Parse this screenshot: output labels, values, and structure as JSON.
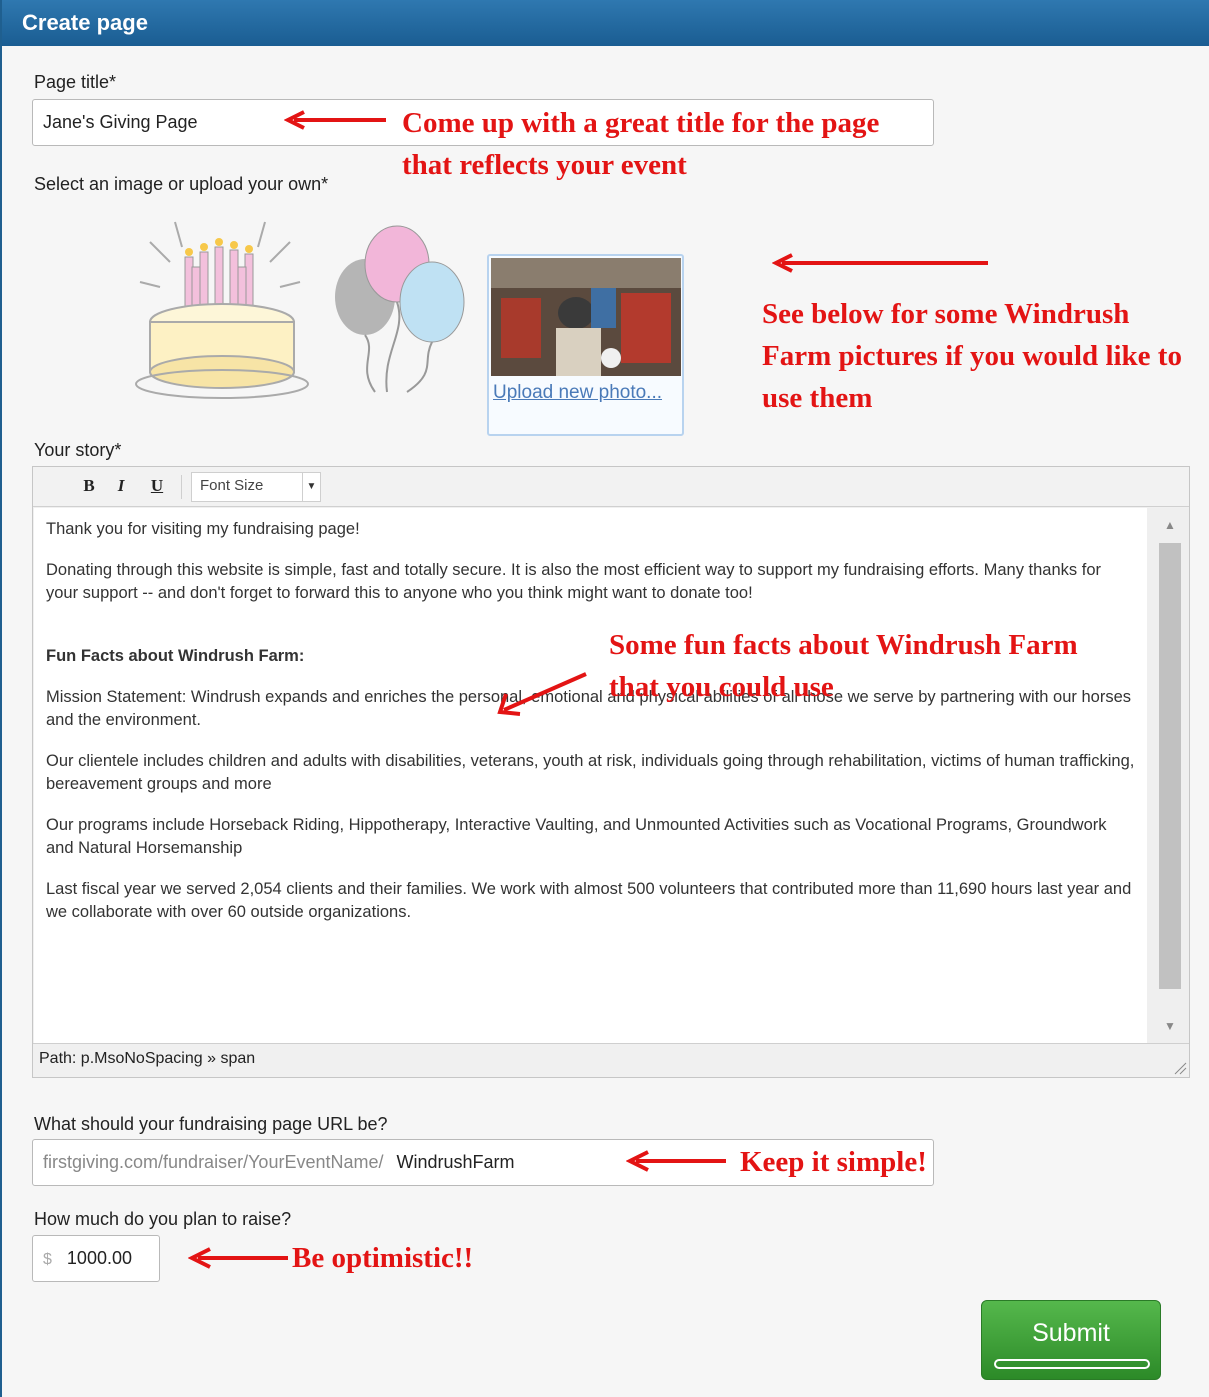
{
  "header": {
    "title": "Create page"
  },
  "page_title": {
    "label": "Page title*",
    "value": "Jane's Giving Page"
  },
  "image_select": {
    "label": "Select an image or upload your own*",
    "upload_link": "Upload new photo..."
  },
  "story": {
    "label": "Your story*",
    "toolbar": {
      "bold": "B",
      "italic": "I",
      "underline": "U",
      "font_size": "Font Size"
    },
    "paragraphs": [
      "Thank you for visiting my fundraising page!",
      "Donating through this website is simple, fast and totally secure. It is also the most efficient way to support my fundraising efforts. Many thanks for your support -- and don't forget to forward this to anyone who you think might want to donate too!",
      "Fun Facts about Windrush Farm:",
      "Mission Statement: Windrush expands and enriches the personal, emotional and physical abilities of all those we serve by partnering with our horses and the environment.",
      "Our clientele includes children and adults with disabilities, veterans, youth at risk, individuals going through rehabilitation, victims of human trafficking, bereavement groups and more",
      "Our programs include Horseback Riding, Hippotherapy, Interactive Vaulting, and Unmounted Activities such as Vocational Programs, Groundwork and Natural Horsemanship",
      "Last fiscal year we served 2,054 clients and their families. We work with almost 500 volunteers that contributed more than 11,690 hours last year and we collaborate with over 60 outside organizations."
    ],
    "path": "Path: p.MsoNoSpacing » span"
  },
  "url": {
    "label": "What should your fundraising page URL be?",
    "prefix": "firstgiving.com/fundraiser/YourEventName/",
    "value": "WindrushFarm"
  },
  "goal": {
    "label": "How much do you plan to raise?",
    "currency": "$",
    "value": "1000.00"
  },
  "submit": {
    "label": "Submit"
  },
  "annotations": {
    "title_note": "Come up with a great title for the page that reflects your event",
    "image_note": "See below for some Windrush Farm pictures if you would like to use them",
    "story_note": "Some fun facts about Windrush Farm that you could use",
    "url_note": "Keep it simple!",
    "goal_note": "Be optimistic!!"
  },
  "colors": {
    "header": "#1f66a0",
    "annotation": "#e31414",
    "submit": "#3fa33a"
  }
}
